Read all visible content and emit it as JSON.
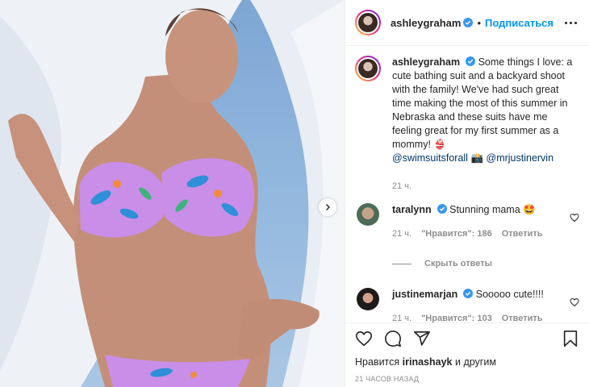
{
  "post": {
    "author": "ashleygraham",
    "follow_label": "Подписаться",
    "separator": "•"
  },
  "caption": {
    "username": "ashleygraham",
    "text": "Some things I love: a cute bathing suit and a backyard shoot with the family! We've had such great time making the most of this summer in Nebraska and these suits have me feeling great for my first summer as a mommy! 👙",
    "mention1": "@swimsuitsforall",
    "camera_emoji": "📸",
    "mention2": "@mrjustinervin",
    "age": "21 ч."
  },
  "comments": [
    {
      "username": "taralynn",
      "text": "Stunning mama 🤩",
      "age": "21 ч.",
      "likes": "\"Нравится\": 186",
      "reply_label": "Ответить"
    },
    {
      "username": "justinemarjan",
      "text": "Sooooo cute!!!!",
      "age": "21 ч.",
      "likes": "\"Нравится\": 103",
      "reply_label": "Ответить"
    }
  ],
  "hide_replies_label": "Скрыть ответы",
  "likes_line": {
    "prefix": "Нравится",
    "user": "irinashayk",
    "suffix": "и другим"
  },
  "timestamp": "21 часов назад",
  "icons": {
    "verified": "verified-badge-icon",
    "more": "more-options-icon",
    "heart": "heart-icon",
    "comment": "comment-icon",
    "share": "share-icon",
    "bookmark": "bookmark-icon",
    "next": "chevron-right-icon"
  },
  "colors": {
    "accent": "#0095f6",
    "verified": "#3897f0",
    "bikini": "#c98ee8",
    "sky": "#8fb5dd"
  }
}
